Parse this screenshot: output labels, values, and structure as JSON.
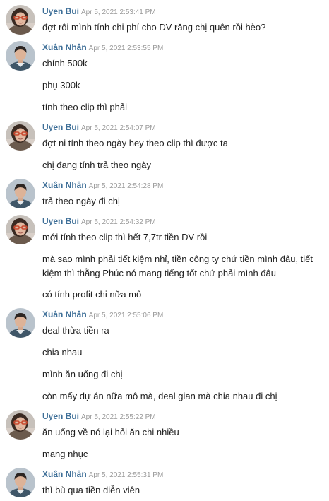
{
  "messages": [
    {
      "author": "Uyen Bui",
      "time": "Apr 5, 2021 2:53:41 PM",
      "avatar": "female-avatar",
      "lines": [
        "đợt rôi mình tính chi phí cho DV răng chị quên rồi hèo?"
      ]
    },
    {
      "author": "Xuân Nhân",
      "time": "Apr 5, 2021 2:53:55 PM",
      "avatar": "male-avatar",
      "lines": [
        "chính 500k",
        "phụ 300k",
        "tính theo clip thì phải"
      ]
    },
    {
      "author": "Uyen Bui",
      "time": "Apr 5, 2021 2:54:07 PM",
      "avatar": "female-avatar",
      "lines": [
        "đợt ni tính theo ngày hey theo clip thì được ta",
        "chị đang tính trả theo ngày"
      ]
    },
    {
      "author": "Xuân Nhân",
      "time": "Apr 5, 2021 2:54:28 PM",
      "avatar": "male-avatar",
      "lines": [
        "trả theo ngày đi chị"
      ]
    },
    {
      "author": "Uyen Bui",
      "time": "Apr 5, 2021 2:54:32 PM",
      "avatar": "female-avatar",
      "lines": [
        "mới tính theo clip thì hết 7,7tr tiền DV rồi",
        "mà sao mình phải tiết kiệm nhỉ, tiền công ty chứ tiền mình đâu, tiết kiệm thì thằng Phúc nó mang tiếng tốt chứ phải mình đâu",
        "có tính profit chi nữa mô"
      ]
    },
    {
      "author": "Xuân Nhân",
      "time": "Apr 5, 2021 2:55:06 PM",
      "avatar": "male-avatar",
      "lines": [
        "deal thừa tiền ra",
        "chia nhau",
        "mình ăn uống đi chị",
        "còn mấy dự án nữa mô mà, deal gian mà chia nhau đi chị"
      ]
    },
    {
      "author": "Uyen Bui",
      "time": "Apr 5, 2021 2:55:22 PM",
      "avatar": "female-avatar",
      "lines": [
        "ăn uống về nó lại hỏi ăn chi nhiều",
        "mang nhục"
      ]
    },
    {
      "author": "Xuân Nhân",
      "time": "Apr 5, 2021 2:55:31 PM",
      "avatar": "male-avatar",
      "lines": [
        "thì bù qua tiền diễn viên"
      ]
    }
  ]
}
